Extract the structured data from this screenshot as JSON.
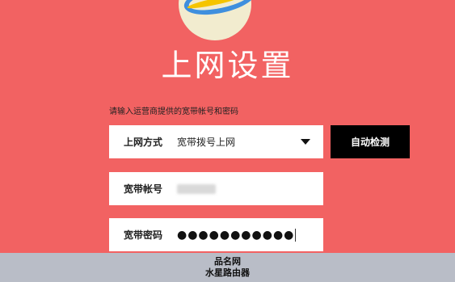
{
  "page": {
    "title": "上网设置",
    "hint": "请输入运营商提供的宽带帐号和密码"
  },
  "form": {
    "connection_type": {
      "label": "上网方式",
      "value": "宽带拨号上网"
    },
    "account": {
      "label": "宽带帐号"
    },
    "password": {
      "label": "宽带密码",
      "masked_value": "●●●●●●●●●●●"
    }
  },
  "buttons": {
    "auto_detect": "自动检测"
  },
  "watermark": {
    "line1": "品名网",
    "line2": "水星路由器"
  },
  "colors": {
    "background": "#f26262",
    "button": "#000000",
    "footer": "#b9bdc7"
  },
  "icons": {
    "logo": "planet-logo-icon",
    "dropdown": "chevron-down-icon"
  }
}
